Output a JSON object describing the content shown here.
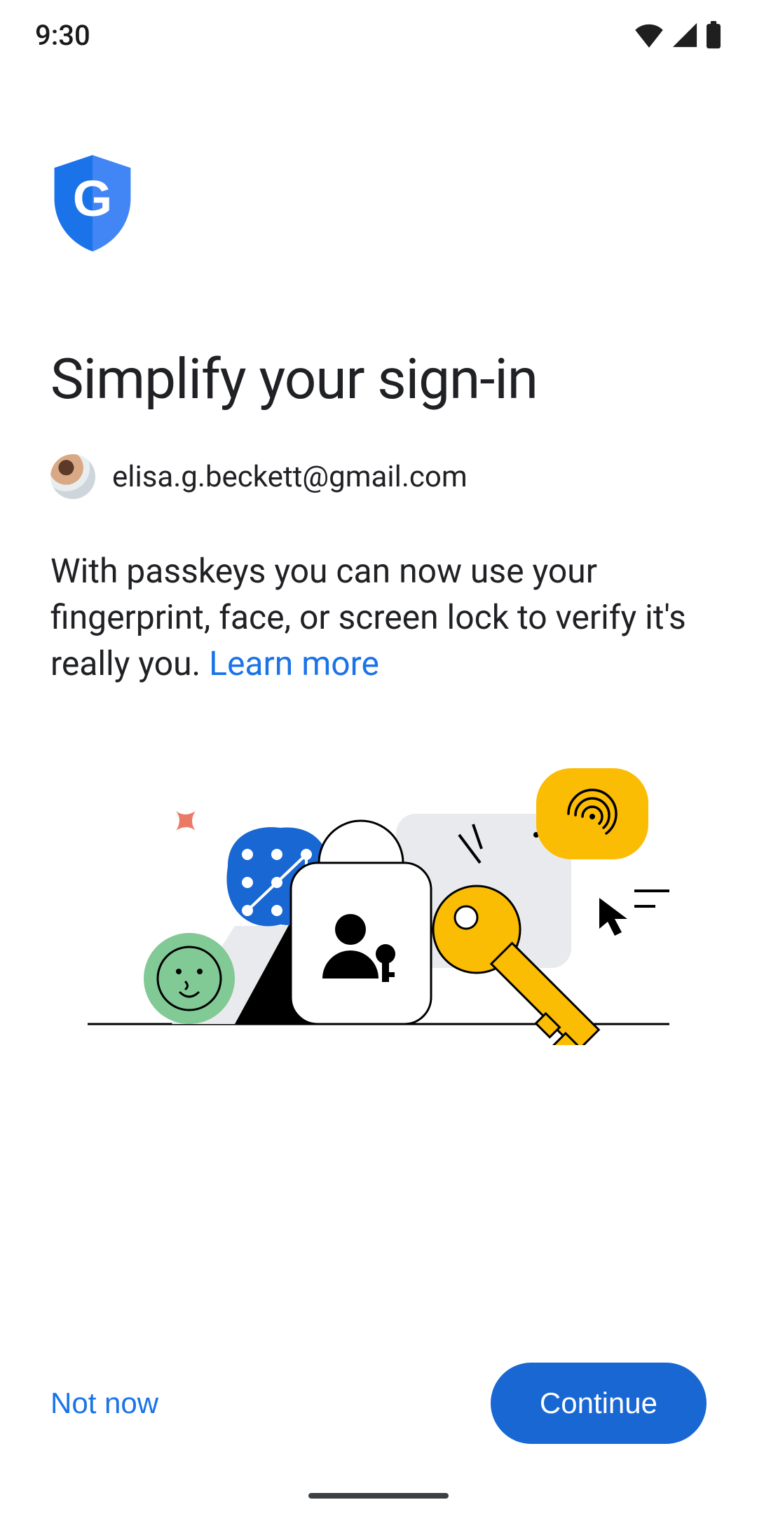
{
  "statusbar": {
    "time": "9:30"
  },
  "header": {
    "title": "Simplify your sign-in"
  },
  "account": {
    "email": "elisa.g.beckett@gmail.com"
  },
  "body": {
    "text": "With passkeys you can now use your fingerprint, face, or screen lock to verify it's really you. ",
    "learn_more": "Learn more"
  },
  "footer": {
    "not_now": "Not now",
    "continue": "Continue"
  },
  "colors": {
    "primary_blue": "#1a73e8",
    "button_blue": "#1967d2",
    "text": "#202124",
    "yellow": "#fbbc04",
    "green": "#81c995",
    "red": "#ea8676"
  }
}
